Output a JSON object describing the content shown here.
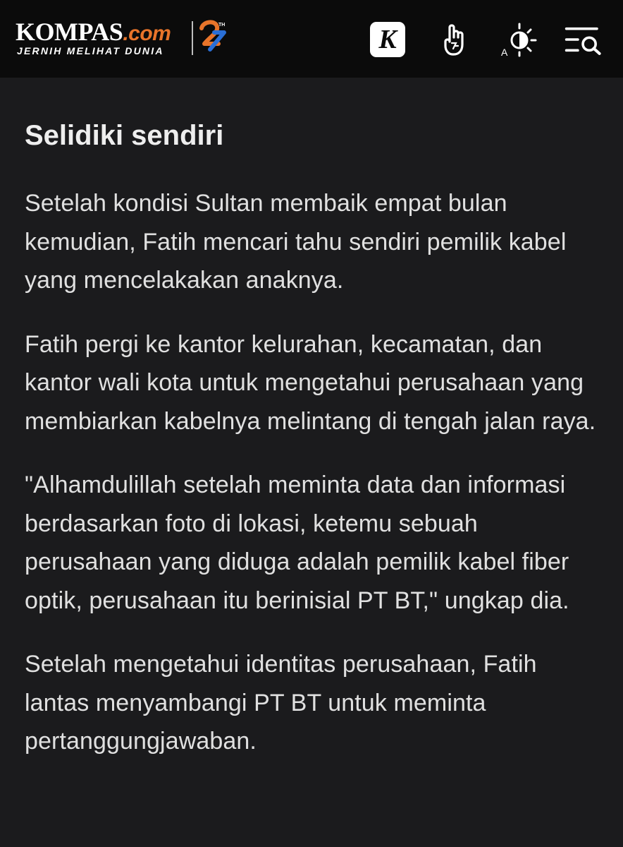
{
  "header": {
    "logo_main": "KOMPAS",
    "logo_suffix": ".com",
    "logo_tagline": "JERNIH MELIHAT DUNIA",
    "logo_badge": "27",
    "nav_icons": [
      "kompas-k-icon",
      "hand-pointer-icon",
      "brightness-contrast-icon",
      "menu-search-icon"
    ],
    "accent_color": "#e8742a",
    "badge_blue": "#2a6fd6"
  },
  "article": {
    "heading": "Selidiki sendiri",
    "paragraphs": [
      "Setelah kondisi Sultan membaik empat bulan kemudian, Fatih mencari tahu sendiri pemilik kabel yang mencelakakan anaknya.",
      "Fatih pergi ke kantor kelurahan, kecamatan, dan kantor wali kota untuk mengetahui perusahaan yang membiarkan kabelnya melintang di tengah jalan raya.",
      "\"Alhamdulillah setelah meminta data dan informasi berdasarkan foto di lokasi, ketemu sebuah perusahaan yang diduga adalah pemilik kabel fiber optik, perusahaan itu berinisial PT BT,\" ungkap dia.",
      "Setelah mengetahui identitas perusahaan, Fatih lantas menyambangi PT BT untuk meminta pertanggungjawaban."
    ]
  }
}
